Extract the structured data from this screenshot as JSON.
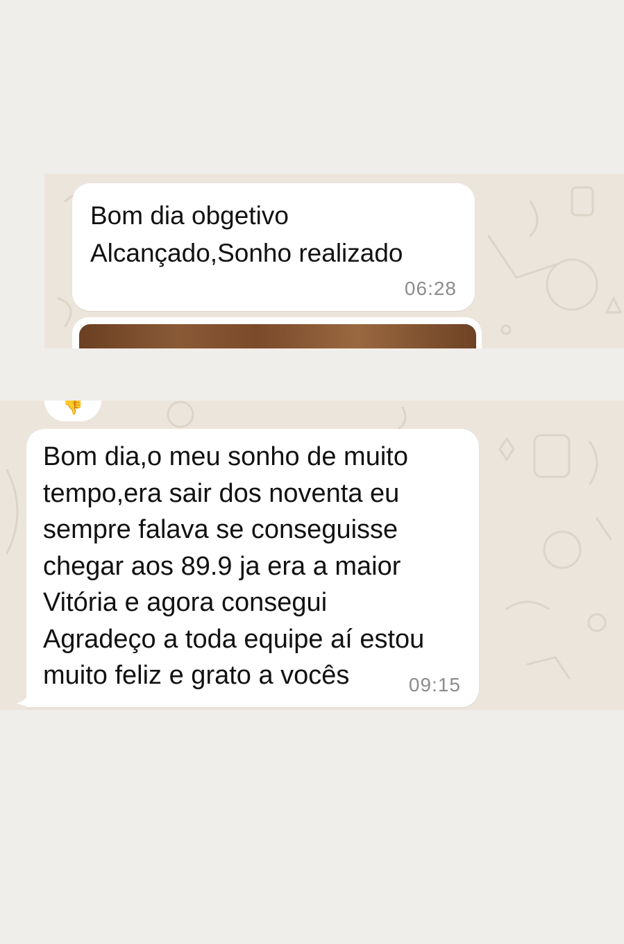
{
  "chat_top": {
    "message": {
      "text": "Bom dia obgetivo\nAlcançado,Sonho realizado",
      "time": "06:28"
    },
    "image_message": {
      "type": "photo"
    }
  },
  "chat_bottom": {
    "reaction": {
      "emoji": "👎"
    },
    "message": {
      "text": "Bom dia,o meu sonho de muito\ntempo,era sair dos noventa eu\nsempre falava se conseguisse\nchegar aos 89.9 ja era a maior\nVitória e agora consegui\nAgradeço a toda equipe aí estou\nmuito feliz e grato a vocês",
      "time": "09:15"
    }
  },
  "colors": {
    "page_background": "#f0eeeb",
    "chat_wallpaper": "#ece5dc",
    "bubble_background": "#ffffff",
    "timestamp_color": "#8c8c8c"
  }
}
